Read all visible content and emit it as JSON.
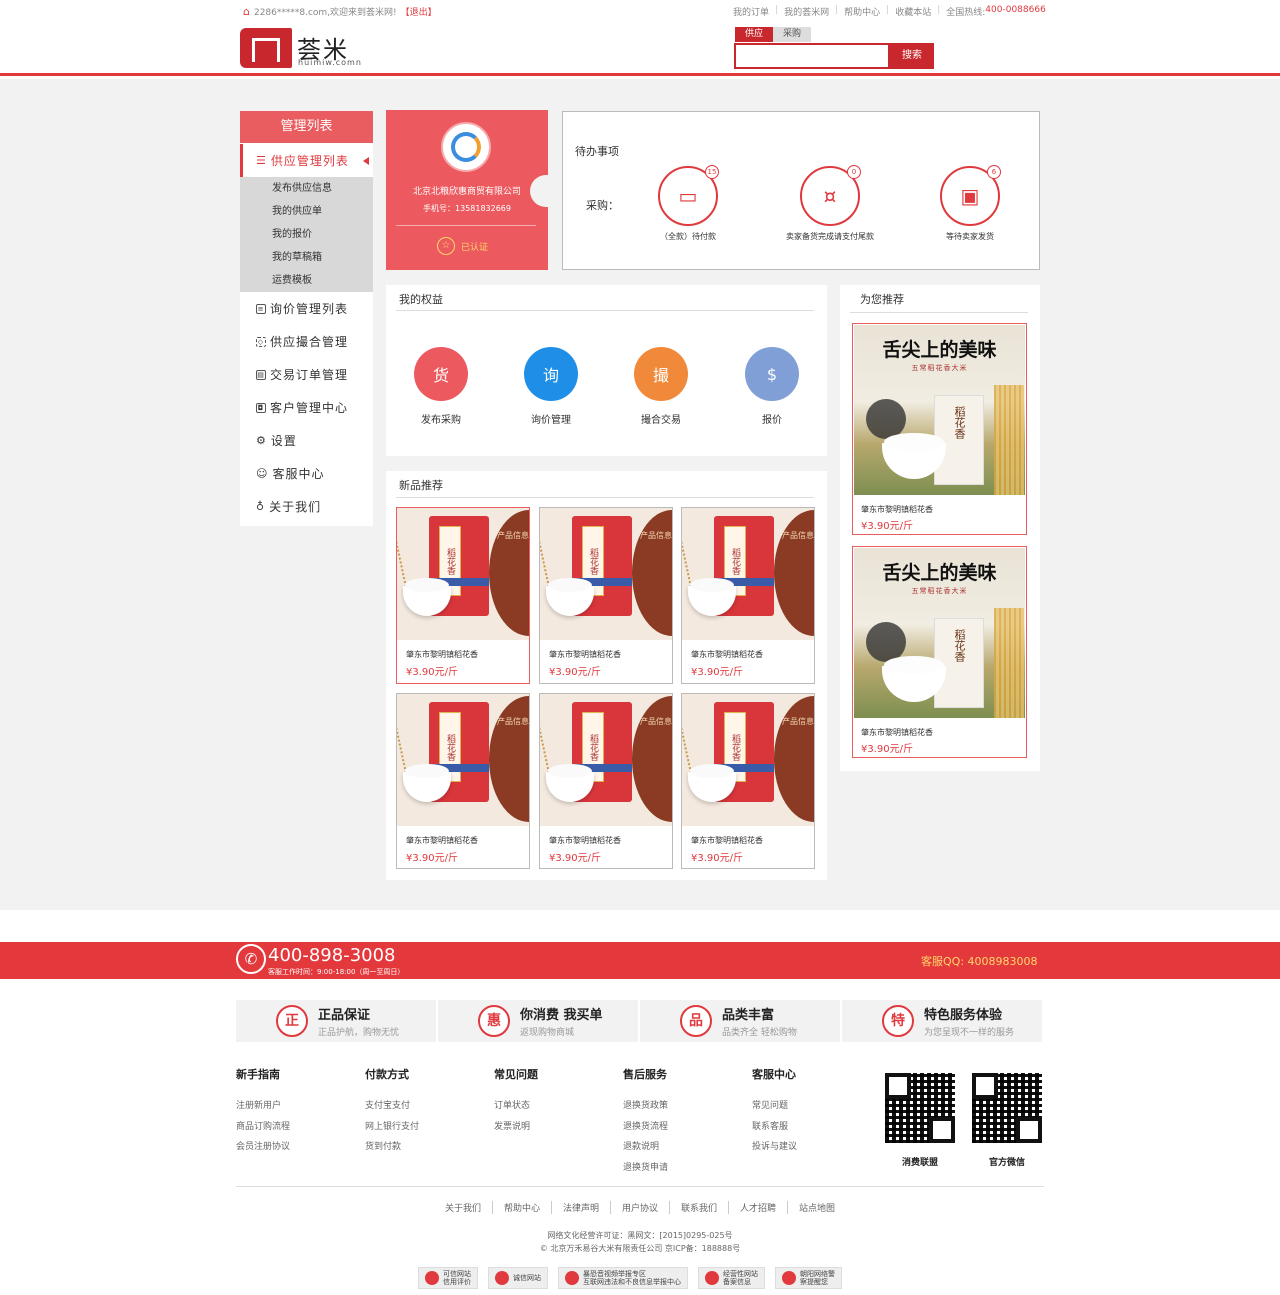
{
  "header": {
    "welcome": "2286*****8.com,欢迎来到荟米网!",
    "logout": "【退出】",
    "links": [
      "我的订单",
      "我的荟米网",
      "帮助中心",
      "收藏本站"
    ],
    "hotline_label": "全国热线:",
    "hotline": "400-0088666",
    "logo_name": "荟米",
    "logo_url": "huimiw.comn",
    "search_tabs": [
      "供应",
      "采购"
    ],
    "search_placeholder": "",
    "search_button": "搜索"
  },
  "sidebar": {
    "title": "管理列表",
    "active_category": "供应管理列表",
    "sub_items": [
      "发布供应信息",
      "我的供应单",
      "我的报价",
      "我的草稿箱",
      "运费模板"
    ],
    "categories": [
      "询价管理列表",
      "供应撮合管理",
      "交易订单管理",
      "客户管理中心",
      "设置",
      "客服中心",
      "关于我们"
    ]
  },
  "profile": {
    "company": "北京北粮欣惠商贸有限公司",
    "phone": "手机号：13581832669",
    "verified": "已认证"
  },
  "todo": {
    "title": "待办事项",
    "label": "采购：",
    "items": [
      {
        "caption": "（全款）待付款",
        "count": "15",
        "icon": "card-hand-icon"
      },
      {
        "caption": "卖家备货完成请支付尾款",
        "count": "0",
        "icon": "coin-hand-icon"
      },
      {
        "caption": "等待卖家发货",
        "count": "6",
        "icon": "gift-hand-icon"
      }
    ]
  },
  "benefits": {
    "title": "我的权益",
    "items": [
      {
        "label": "发布采购",
        "glyph": "货",
        "color": "#ec5a5f"
      },
      {
        "label": "询价管理",
        "glyph": "询",
        "color": "#1e8ee6"
      },
      {
        "label": "撮合交易",
        "glyph": "撮",
        "color": "#f08a3a"
      },
      {
        "label": "报价",
        "glyph": "$",
        "color": "#7f9fd6"
      }
    ]
  },
  "new_products": {
    "title": "新品推荐",
    "items": [
      {
        "name": "肇东市黎明镇稻花香",
        "price": "¥3.90元/斤"
      },
      {
        "name": "肇东市黎明镇稻花香",
        "price": "¥3.90元/斤"
      },
      {
        "name": "肇东市黎明镇稻花香",
        "price": "¥3.90元/斤"
      },
      {
        "name": "肇东市黎明镇稻花香",
        "price": "¥3.90元/斤"
      },
      {
        "name": "肇东市黎明镇稻花香",
        "price": "¥3.90元/斤"
      },
      {
        "name": "肇东市黎明镇稻花香",
        "price": "¥3.90元/斤"
      }
    ],
    "bag_text": "稻花香",
    "info_text": "产品信息"
  },
  "recommend": {
    "title": "为您推荐",
    "headline": "舌尖上的美味",
    "subline": "五常稻花香大米",
    "bag_text": "稻花香",
    "items": [
      {
        "name": "肇东市黎明镇稻花香",
        "price": "¥3.90元/斤"
      },
      {
        "name": "肇东市黎明镇稻花香",
        "price": "¥3.90元/斤"
      }
    ]
  },
  "footer": {
    "hotline": "400-898-3008",
    "hours": "客服工作时间：9:00-18:00（周一至周日）",
    "qq": "客服QQ: 4008983008",
    "features": [
      {
        "glyph": "正",
        "title": "正品保证",
        "sub": "正品护航，购物无忧"
      },
      {
        "glyph": "惠",
        "title": "你消费 我买单",
        "sub": "返现购物商城"
      },
      {
        "glyph": "品",
        "title": "品类丰富",
        "sub": "品类齐全  轻松购物"
      },
      {
        "glyph": "特",
        "title": "特色服务体验",
        "sub": "为您呈现不一样的服务"
      }
    ],
    "columns": [
      {
        "title": "新手指南",
        "links": [
          "注册新用户",
          "商品订购流程",
          "会员注册协议"
        ]
      },
      {
        "title": "付款方式",
        "links": [
          "支付宝支付",
          "网上银行支付",
          "货到付款"
        ]
      },
      {
        "title": "常见问题",
        "links": [
          "订单状态",
          "发票说明"
        ]
      },
      {
        "title": "售后服务",
        "links": [
          "退换货政策",
          "退换货流程",
          "退款说明",
          "退换货申请"
        ]
      },
      {
        "title": "客服中心",
        "links": [
          "常见问题",
          "联系客服",
          "投诉与建议"
        ]
      }
    ],
    "qr_captions": [
      "消费联盟",
      "官方微信"
    ],
    "bottom_links": [
      "关于我们",
      "帮助中心",
      "法律声明",
      "用户协议",
      "联系我们",
      "人才招聘",
      "站点地图"
    ],
    "license_1": "网络文化经营许可证：黑网文：[2015]0295-025号",
    "license_2": "© 北京万禾易谷大米有限责任公司  京ICP备：188888号",
    "badges": [
      [
        "可信网站",
        "信用评价"
      ],
      [
        "诚信网站",
        ""
      ],
      [
        "暴恐音视频举报专区",
        "互联网违法和不良信息举报中心"
      ],
      [
        "经营性网站",
        "备案信息"
      ],
      [
        "朝阳网络警",
        "察提醒您"
      ]
    ]
  }
}
